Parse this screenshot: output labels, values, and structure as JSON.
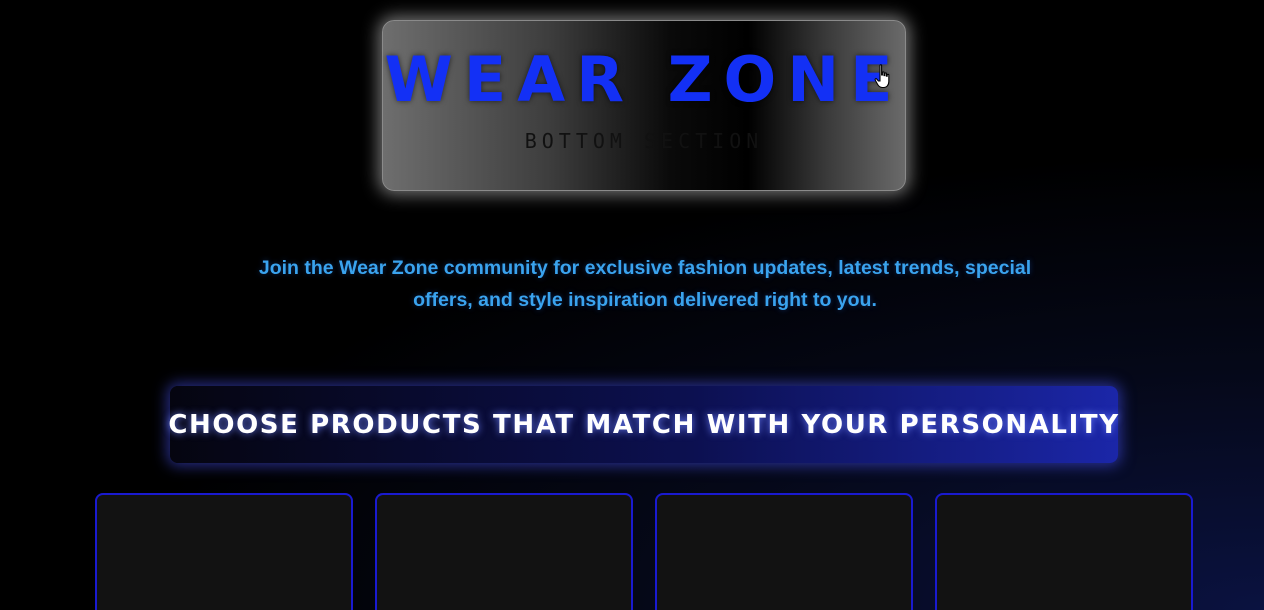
{
  "header": {
    "brand_title": "WEAR ZONE",
    "brand_subtitle": "BOTTOM SECTION"
  },
  "intro": {
    "text": "Join the Wear Zone community for exclusive fashion updates, latest trends, special offers, and style inspiration delivered right to you."
  },
  "cta": {
    "label": "CHOOSE PRODUCTS THAT MATCH WITH YOUR PERSONALITY"
  },
  "products": [
    {
      "id": 1
    },
    {
      "id": 2
    },
    {
      "id": 3
    },
    {
      "id": 4
    }
  ],
  "icons": {
    "cursor": "hand-pointer-cursor-icon"
  },
  "colors": {
    "brand_blue": "#1330f5",
    "intro_text": "#3aa3ee",
    "card_border": "#1a1ad0",
    "card_bg": "#121212"
  }
}
